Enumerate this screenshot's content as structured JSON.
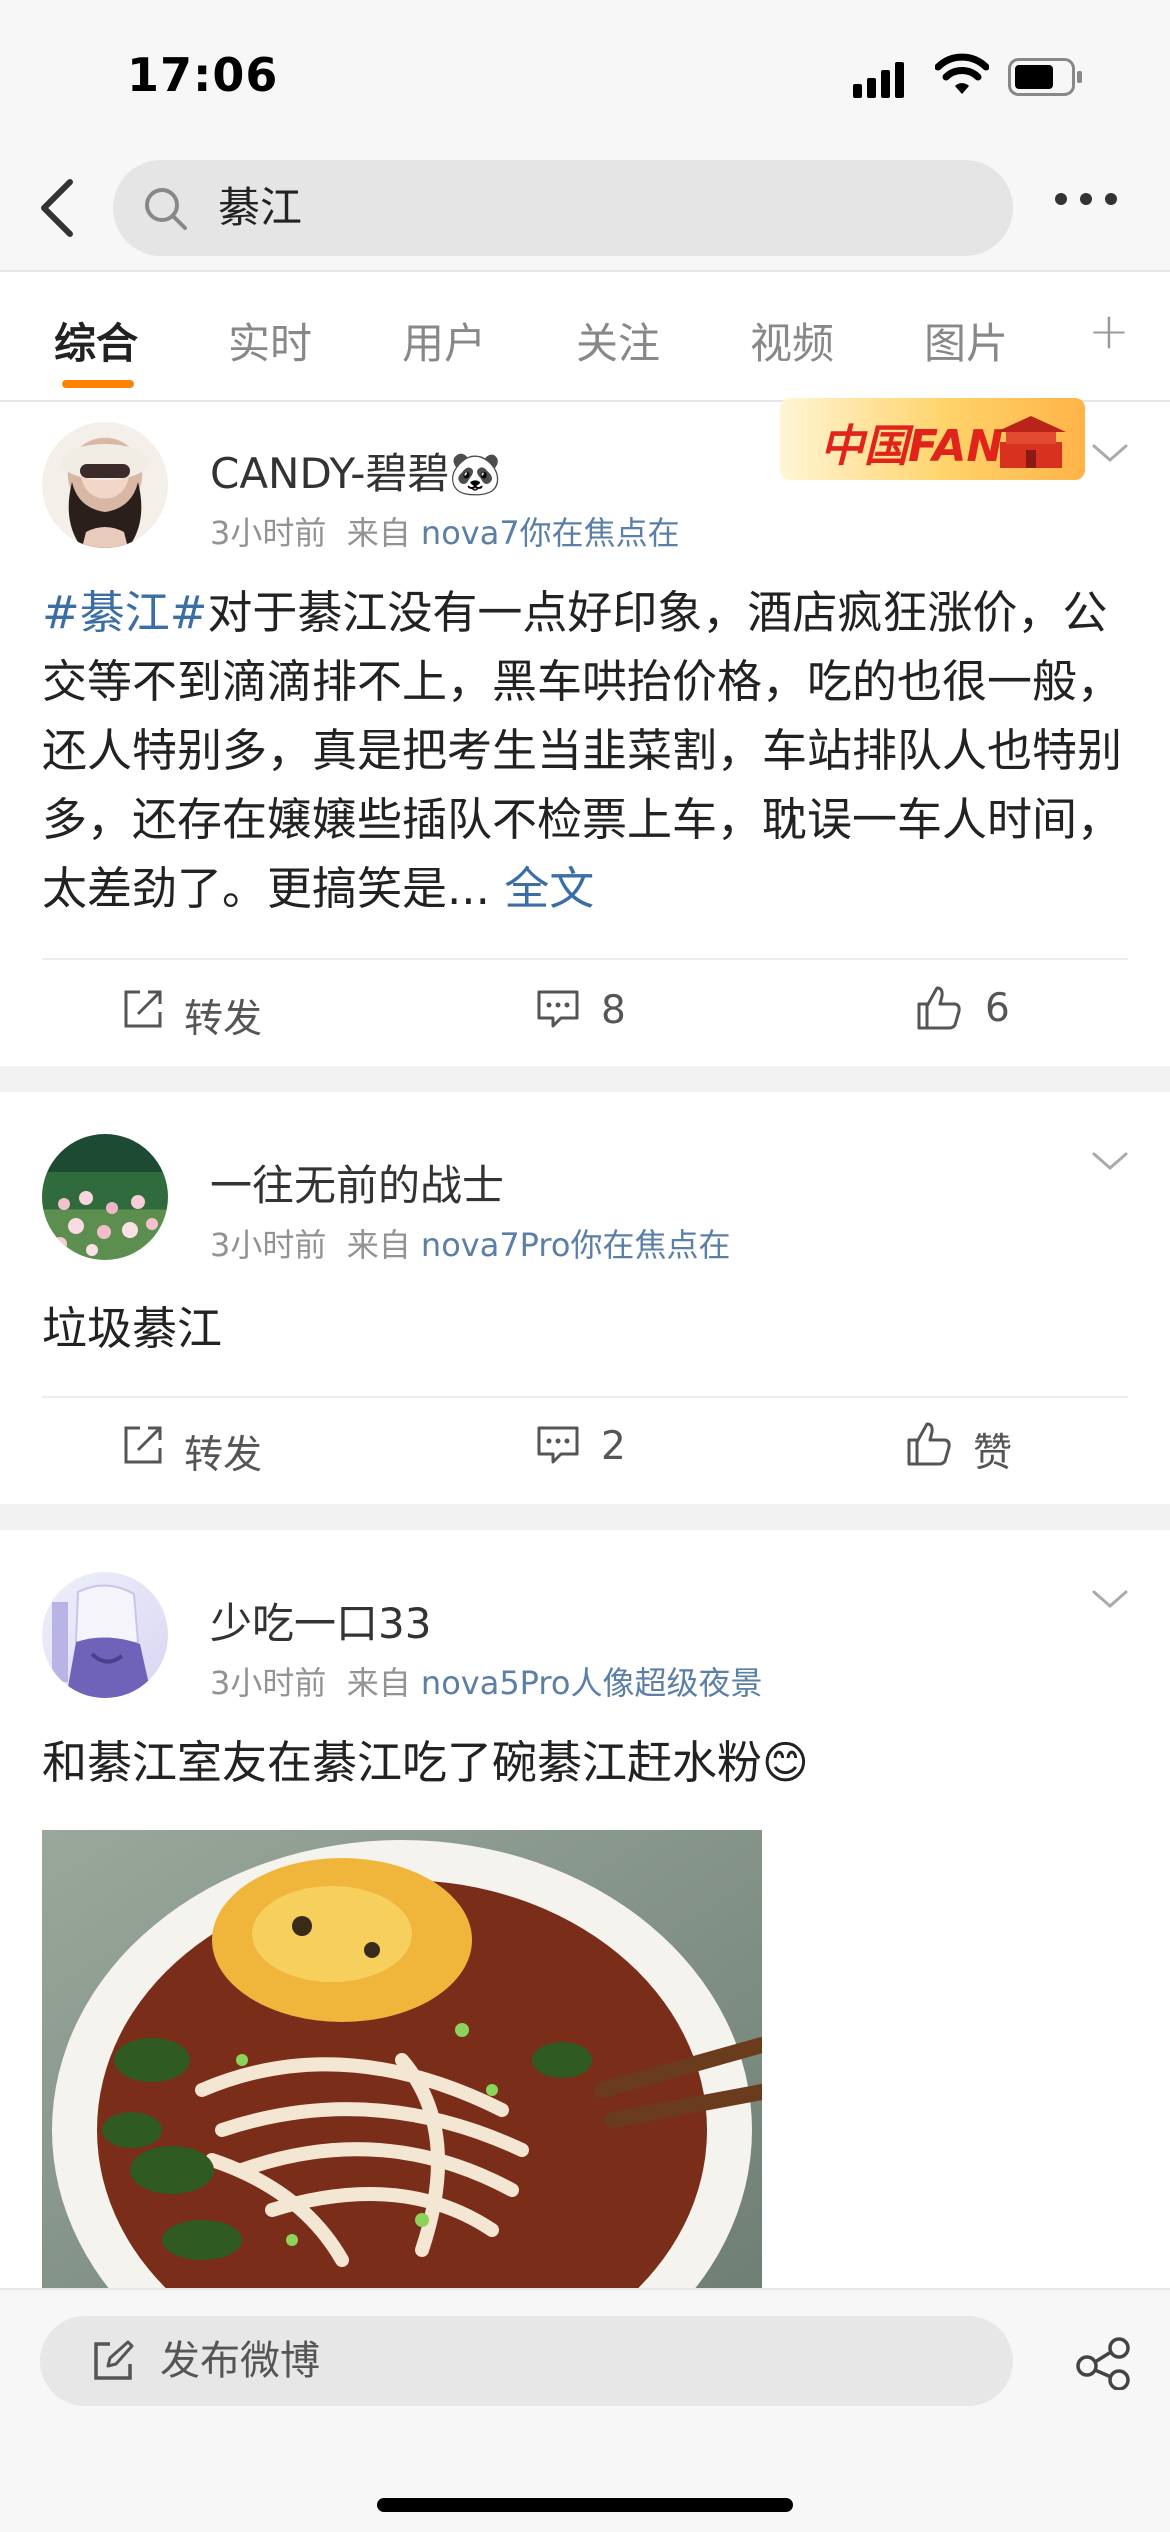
{
  "status_bar": {
    "time": "17:06"
  },
  "search": {
    "query": "綦江"
  },
  "tabs": [
    {
      "label": "综合",
      "active": true
    },
    {
      "label": "实时"
    },
    {
      "label": "用户"
    },
    {
      "label": "关注"
    },
    {
      "label": "视频"
    },
    {
      "label": "图片"
    }
  ],
  "tab_plus": "+",
  "posts": [
    {
      "username": "CANDY-碧碧🐼",
      "time": "3小时前",
      "source_prefix": "来自",
      "source": "nova7你在焦点在",
      "badge": "中国FANS",
      "hashtag": "#綦江#",
      "text": "对于綦江没有一点好印象，酒店疯狂涨价，公交等不到滴滴排不上，黑车哄抬价格，吃的也很一般，还人特别多，真是把考生当韭菜割，车站排队人也特别多，还存在嬢嬢些插队不检票上车，耽误一车人时间，太差劲了。更搞笑是...",
      "full_text_link": "全文",
      "repost": "转发",
      "comments": "8",
      "likes": "6"
    },
    {
      "username": "一往无前的战士",
      "time": "3小时前",
      "source_prefix": "来自",
      "source": "nova7Pro你在焦点在",
      "text": "垃圾綦江",
      "repost": "转发",
      "comments": "2",
      "likes": "赞"
    },
    {
      "username": "少吃一口33",
      "time": "3小时前",
      "source_prefix": "来自",
      "source": "nova5Pro人像超级夜景",
      "text": "和綦江室友在綦江吃了碗綦江赶水粉😊"
    }
  ],
  "bottom_bar": {
    "compose_label": "发布微博"
  },
  "colors": {
    "accent": "#ff8200",
    "link": "#3b6ea5",
    "source": "#5b7fa6"
  }
}
